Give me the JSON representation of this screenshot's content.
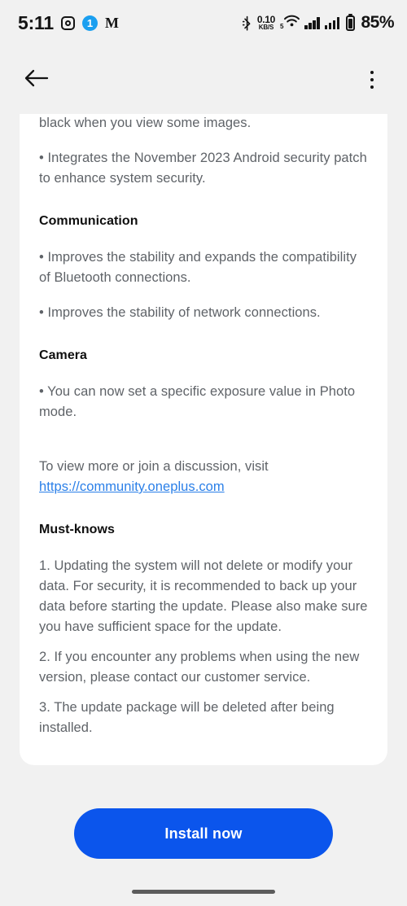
{
  "statusbar": {
    "time": "5:11",
    "instagram_icon": "instagram-icon",
    "notification_badge": "1",
    "gmail_icon": "gmail-icon",
    "bluetooth_icon": "bluetooth-icon",
    "data_rate_value": "0.10",
    "data_rate_unit": "KB/S",
    "wifi_icon": "wifi-icon",
    "wifi_band": "5",
    "signal_icon_1": "signal-bars-icon",
    "signal_icon_2": "signal-bars-icon",
    "battery_icon": "battery-icon",
    "battery_percent": "85%"
  },
  "appbar": {
    "back_icon": "back-arrow-icon",
    "overflow_icon": "more-options-icon"
  },
  "content": {
    "cutoff_paragraph": "• Fixes an issue that might cause the screen to go black when you view some images.",
    "security_patch_paragraph": "• Integrates the November 2023 Android security patch to enhance system security.",
    "communication_heading": "Communication",
    "communication_items": [
      "• Improves the stability and expands the compatibility of Bluetooth connections.",
      "• Improves the stability of network connections."
    ],
    "camera_heading": "Camera",
    "camera_items": [
      "• You can now set a specific exposure value in Photo mode."
    ],
    "discussion_prefix": "To view more or join a discussion, visit ",
    "discussion_link": "https://community.oneplus.com",
    "must_knows_heading": "Must-knows",
    "must_knows": [
      "1. Updating the system will not delete or modify your data. For security, it is recommended to back up your data before starting the update. Please also make sure you have sufficient space for the update.",
      "2. If you encounter any problems when using the new version, please contact our customer service.",
      "3. The update package will be deleted after being installed."
    ]
  },
  "bottom": {
    "install_label": "Install now",
    "home_indicator": "home-indicator"
  },
  "colors": {
    "accent_blue": "#0b55ec",
    "link_blue": "#2a7fe8",
    "badge_blue": "#1a9ff0",
    "page_background": "#f1f1f1",
    "card_background": "#ffffff",
    "body_text": "#5f6368",
    "heading_text": "#0f0f0f"
  }
}
